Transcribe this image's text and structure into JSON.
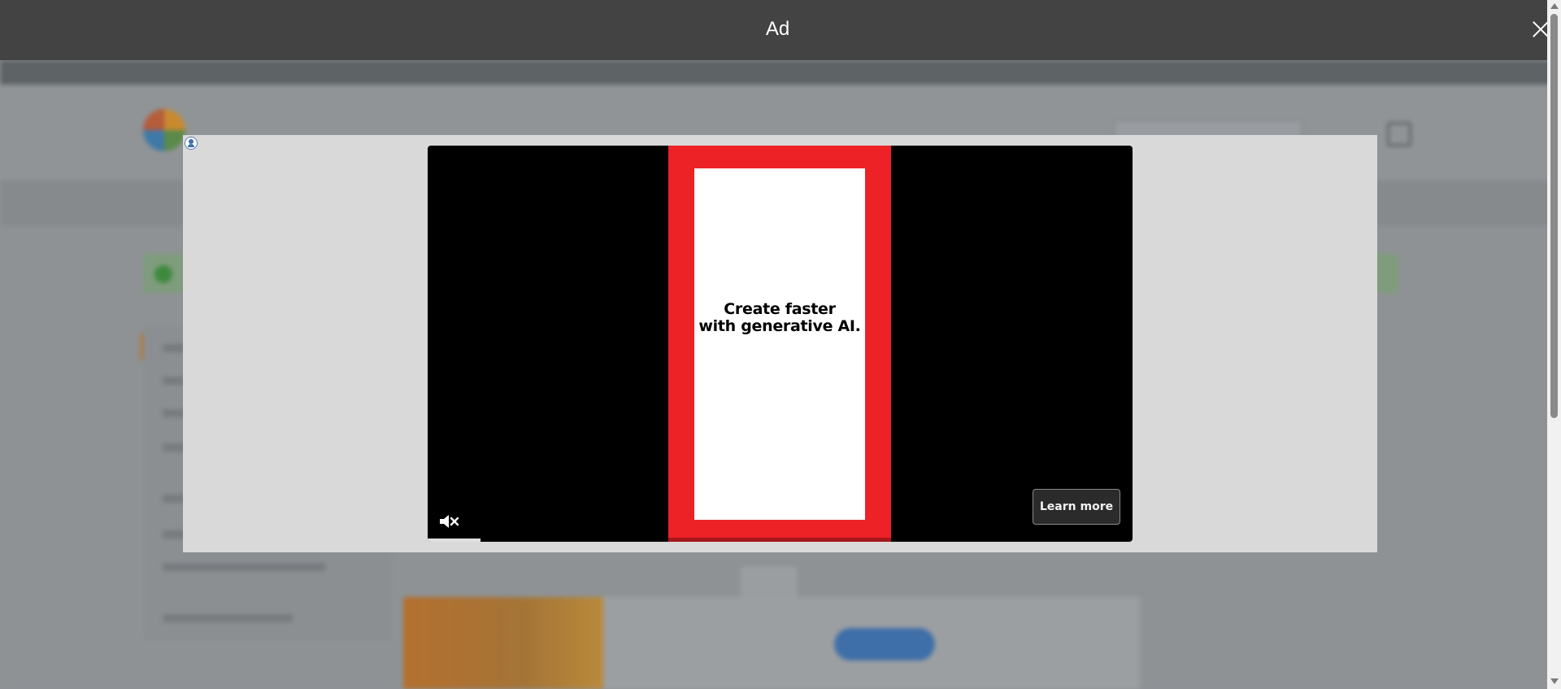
{
  "ad": {
    "title": "Ad",
    "close_label": "Close",
    "video": {
      "headline_line1": "Create faster",
      "headline_line2": "with generative AI.",
      "cta_label": "Learn more",
      "muted": true,
      "progress": 0.075
    },
    "colors": {
      "creative_red": "#ec2227",
      "topbar": "#434343"
    }
  },
  "icons": {
    "close": "close-icon",
    "adchoices": "adchoices-icon",
    "mute": "muted-speaker-icon"
  }
}
